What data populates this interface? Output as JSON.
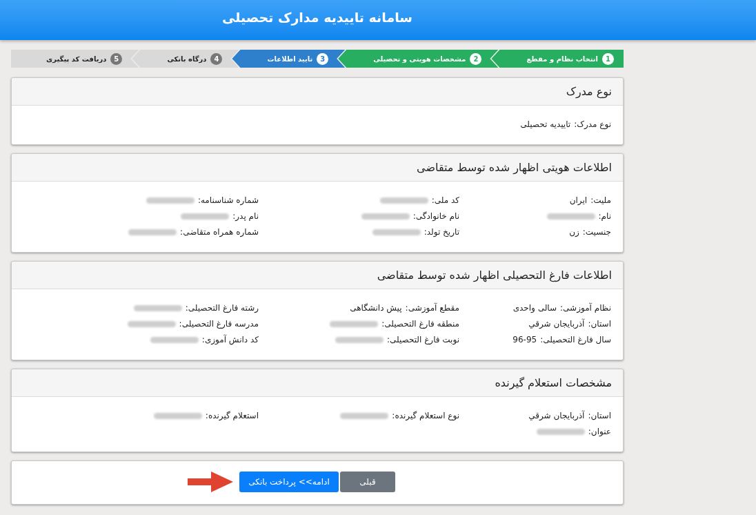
{
  "header": {
    "title": "سامانه تاییدیه مدارک تحصیلی"
  },
  "steps": [
    {
      "number": "1",
      "label": "انتخاب نظام و مقطع",
      "completed": true,
      "active": false
    },
    {
      "number": "2",
      "label": "مشخصات هویتی و تحصیلی",
      "completed": true,
      "active": false
    },
    {
      "number": "3",
      "label": "تایید اطلاعات",
      "completed": false,
      "active": true
    },
    {
      "number": "4",
      "label": "درگاه بانکی",
      "completed": false,
      "active": false
    },
    {
      "number": "5",
      "label": "دریافت کد پیگیری",
      "completed": false,
      "active": false
    }
  ],
  "panels": [
    {
      "title": "نوع مدرک",
      "fields": [
        {
          "label": "نوع مدرک:",
          "value": "تاییدیه تحصیلی",
          "blurred": false
        }
      ]
    },
    {
      "title": "اطلاعات هویتی اظهار شده توسط متقاضی",
      "fields": [
        {
          "label": "ملیت:",
          "value": "ایران",
          "blurred": false
        },
        {
          "label": "کد ملی:",
          "blurred": true
        },
        {
          "label": "شماره شناسنامه:",
          "blurred": true
        },
        {
          "label": "نام:",
          "blurred": true
        },
        {
          "label": "نام خانوادگی:",
          "blurred": true
        },
        {
          "label": "نام پدر:",
          "blurred": true
        },
        {
          "label": "جنسیت:",
          "value": "زن",
          "blurred": false
        },
        {
          "label": "تاریخ تولد:",
          "blurred": true
        },
        {
          "label": "شماره همراه متقاضی:",
          "blurred": true
        }
      ]
    },
    {
      "title": "اطلاعات فارغ التحصیلی اظهار شده توسط متقاضی",
      "fields": [
        {
          "label": "نظام آموزشی:",
          "value": "سالی واحدی",
          "blurred": false
        },
        {
          "label": "مقطع آموزشی:",
          "value": "پیش دانشگاهی",
          "blurred": false
        },
        {
          "label": "رشته فارغ التحصیلی:",
          "blurred": true
        },
        {
          "label": "استان:",
          "value": "آذربایجان شرقي",
          "blurred": false
        },
        {
          "label": "منطقه فارغ التحصیلی:",
          "blurred": true
        },
        {
          "label": "مدرسه فارغ التحصیلی:",
          "blurred": true
        },
        {
          "label": "سال فارغ التحصیلی:",
          "value": "96-95",
          "blurred": false
        },
        {
          "label": "نوبت فارغ التحصیلی:",
          "blurred": true
        },
        {
          "label": "کد دانش آموزی:",
          "blurred": true
        }
      ]
    },
    {
      "title": "مشخصات استعلام گیرنده",
      "fields": [
        {
          "label": "استان:",
          "value": "آذربایجان شرقي",
          "blurred": false
        },
        {
          "label": "نوع استعلام گیرنده:",
          "blurred": true
        },
        {
          "label": "استعلام گیرنده:",
          "blurred": true
        },
        {
          "label": "عنوان:",
          "blurred": true
        }
      ]
    }
  ],
  "actions": {
    "buttons": [
      {
        "label": "قبلی",
        "kind": "secondary"
      },
      {
        "label": "ادامه>> پرداخت بانکی",
        "kind": "primary"
      }
    ],
    "pointer_arrow": true
  }
}
